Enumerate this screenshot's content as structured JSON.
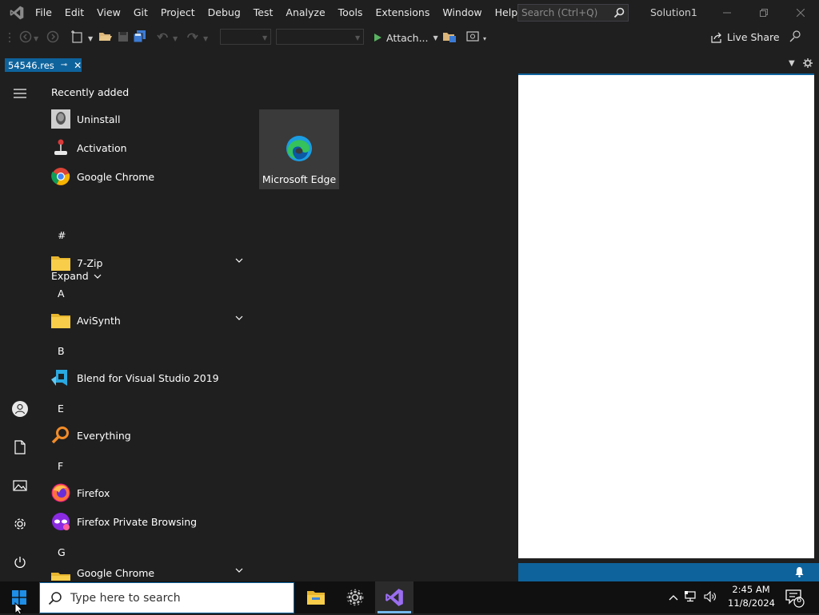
{
  "vs": {
    "menu": [
      "File",
      "Edit",
      "View",
      "Git",
      "Project",
      "Debug",
      "Test",
      "Analyze",
      "Tools",
      "Extensions",
      "Window",
      "Help"
    ],
    "search_placeholder": "Search (Ctrl+Q)",
    "solution_name": "Solution1",
    "attach_label": "Attach...",
    "live_share_label": "Live Share",
    "doc_tab_label": "54546.res",
    "colors": {
      "accent": "#0e639c",
      "background": "#1f1f1f"
    }
  },
  "start_menu": {
    "recently_added_title": "Recently added",
    "recent": [
      {
        "label": "Uninstall",
        "icon": "uninstall-icon"
      },
      {
        "label": "Activation",
        "icon": "joystick-icon"
      },
      {
        "label": "Google Chrome",
        "icon": "chrome-icon"
      }
    ],
    "expand_label": "Expand",
    "groups": [
      {
        "letter": "#",
        "items": [
          {
            "label": "7-Zip",
            "icon": "folder-icon",
            "expandable": true
          }
        ]
      },
      {
        "letter": "A",
        "items": [
          {
            "label": "AviSynth",
            "icon": "folder-icon",
            "expandable": true
          }
        ]
      },
      {
        "letter": "B",
        "items": [
          {
            "label": "Blend for Visual Studio 2019",
            "icon": "blend-icon"
          }
        ]
      },
      {
        "letter": "E",
        "items": [
          {
            "label": "Everything",
            "icon": "magnifier-icon"
          }
        ]
      },
      {
        "letter": "F",
        "items": [
          {
            "label": "Firefox",
            "icon": "firefox-icon"
          },
          {
            "label": "Firefox Private Browsing",
            "icon": "firefox-private-icon"
          }
        ]
      },
      {
        "letter": "G",
        "items": [
          {
            "label": "Google Chrome",
            "icon": "folder-icon",
            "expandable": true
          }
        ]
      }
    ],
    "tile": {
      "label": "Microsoft Edge",
      "icon": "edge-icon"
    }
  },
  "taskbar": {
    "search_placeholder": "Type here to search",
    "time": "2:45 AM",
    "date": "11/8/2024",
    "notification_count": "6"
  }
}
